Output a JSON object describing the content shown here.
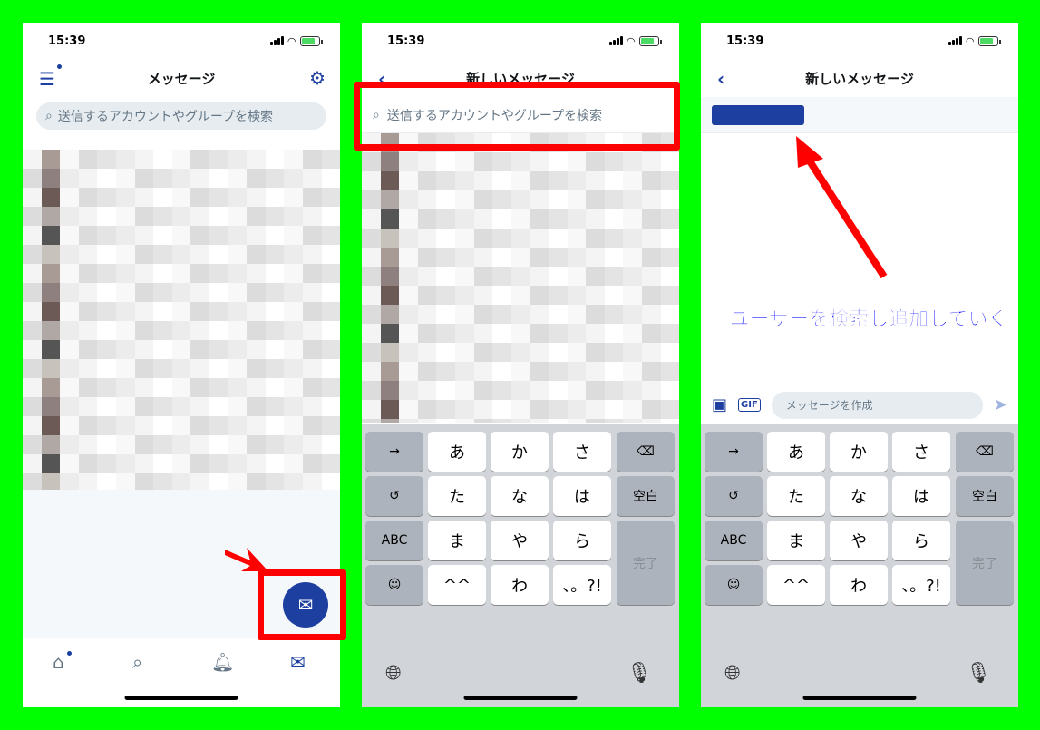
{
  "status_bar": {
    "time": "15:39"
  },
  "screen1": {
    "title": "メッセージ",
    "menu_icon": "hamburger-menu-icon",
    "settings_icon": "gear-icon",
    "search_placeholder": "送信するアカウントやグループを検索",
    "fab_icon": "new-message-icon",
    "tabs": [
      {
        "name": "home",
        "icon": "home-icon"
      },
      {
        "name": "search",
        "icon": "search-icon"
      },
      {
        "name": "notifications",
        "icon": "bell-icon"
      },
      {
        "name": "messages",
        "icon": "mail-icon",
        "active": true
      }
    ]
  },
  "screen2": {
    "title": "新しいメッセージ",
    "search_placeholder": "送信するアカウントやグループを検索"
  },
  "screen3": {
    "title": "新しいメッセージ",
    "compose_placeholder": "メッセージを作成",
    "gif_label": "GIF",
    "annotation": "ユーザーを検索し追加していく"
  },
  "keyboard": {
    "rows": [
      [
        "→",
        "あ",
        "か",
        "さ",
        "⌫"
      ],
      [
        "↺",
        "た",
        "な",
        "は",
        "空白"
      ],
      [
        "ABC",
        "ま",
        "や",
        "ら",
        "完了"
      ],
      [
        "☺",
        "^^",
        "わ",
        "、。?!"
      ]
    ],
    "globe": "globe-icon",
    "mic": "microphone-icon"
  },
  "colors": {
    "accent": "#1d3fa0",
    "highlight": "#ff0000",
    "background": "#00ff00",
    "annotation": "#0000ff"
  }
}
